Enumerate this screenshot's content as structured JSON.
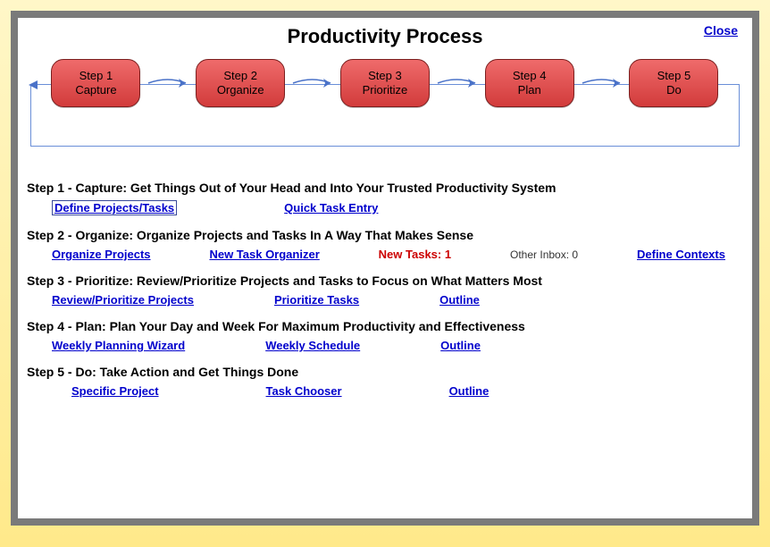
{
  "close_label": "Close",
  "title": "Productivity Process",
  "flow": {
    "steps": [
      {
        "num": "Step 1",
        "name": "Capture"
      },
      {
        "num": "Step 2",
        "name": "Organize"
      },
      {
        "num": "Step 3",
        "name": "Prioritize"
      },
      {
        "num": "Step 4",
        "name": "Plan"
      },
      {
        "num": "Step 5",
        "name": "Do"
      }
    ]
  },
  "sections": {
    "s1": {
      "heading": "Step 1 - Capture: Get Things Out of Your Head and Into Your Trusted Productivity System",
      "links": {
        "define": "Define Projects/Tasks",
        "quick": "Quick Task Entry"
      }
    },
    "s2": {
      "heading": "Step 2 - Organize: Organize Projects and Tasks In A Way That Makes Sense",
      "links": {
        "org_projects": "Organize Projects",
        "new_task_org": "New Task Organizer",
        "define_contexts": "Define Contexts"
      },
      "new_tasks_label": "New Tasks:",
      "new_tasks_count": "1",
      "other_inbox_label": "Other Inbox:",
      "other_inbox_count": "0"
    },
    "s3": {
      "heading": "Step 3 - Prioritize: Review/Prioritize Projects and Tasks to Focus on What Matters Most",
      "links": {
        "review": "Review/Prioritize Projects",
        "prioritize_tasks": "Prioritize Tasks",
        "outline": "Outline"
      }
    },
    "s4": {
      "heading": "Step 4 - Plan: Plan Your Day and Week For Maximum Productivity and Effectiveness",
      "links": {
        "weekly_wizard": "Weekly Planning Wizard",
        "weekly_schedule": "Weekly Schedule",
        "outline": "Outline"
      }
    },
    "s5": {
      "heading": "Step 5 - Do: Take Action and Get Things Done",
      "links": {
        "specific_project": "Specific Project",
        "task_chooser": "Task Chooser",
        "outline": "Outline"
      }
    }
  }
}
